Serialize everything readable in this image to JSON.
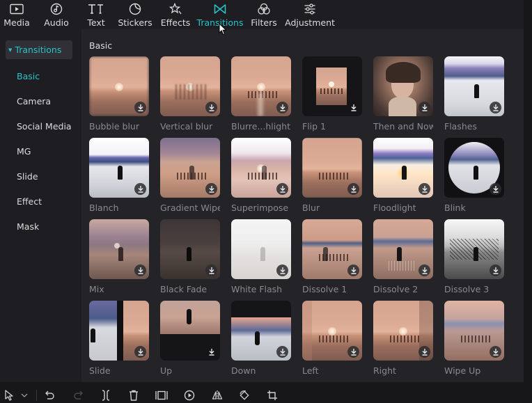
{
  "tabs": [
    {
      "label": "Media",
      "icon": "media-icon"
    },
    {
      "label": "Audio",
      "icon": "audio-icon"
    },
    {
      "label": "Text",
      "icon": "text-icon"
    },
    {
      "label": "Stickers",
      "icon": "stickers-icon"
    },
    {
      "label": "Effects",
      "icon": "effects-icon"
    },
    {
      "label": "Transitions",
      "icon": "transitions-icon",
      "active": true
    },
    {
      "label": "Filters",
      "icon": "filters-icon"
    },
    {
      "label": "Adjustment",
      "icon": "adjustment-icon"
    }
  ],
  "sidebar": {
    "header": "Transitions",
    "items": [
      {
        "label": "Basic",
        "active": true
      },
      {
        "label": "Camera"
      },
      {
        "label": "Social Media"
      },
      {
        "label": "MG"
      },
      {
        "label": "Slide"
      },
      {
        "label": "Effect"
      },
      {
        "label": "Mask"
      }
    ]
  },
  "main": {
    "section_title": "Basic",
    "items": [
      {
        "label": "Bubble blur",
        "style": "blur"
      },
      {
        "label": "Vertical blur",
        "style": "vblur"
      },
      {
        "label": "Blurre...hlight",
        "style": "sunset"
      },
      {
        "label": "Flip 1",
        "style": "flip"
      },
      {
        "label": "Then and Now",
        "style": "portrait"
      },
      {
        "label": "Flashes",
        "style": "blue"
      },
      {
        "label": "Blanch",
        "style": "blue-bright"
      },
      {
        "label": "Gradient Wipe",
        "style": "gradient"
      },
      {
        "label": "Superimpose",
        "style": "superimpose"
      },
      {
        "label": "Blur",
        "style": "sunset-blur"
      },
      {
        "label": "Floodlight",
        "style": "floodlight"
      },
      {
        "label": "Blink",
        "style": "blink"
      },
      {
        "label": "Mix",
        "style": "mix"
      },
      {
        "label": "Black Fade",
        "style": "dark"
      },
      {
        "label": "White Flash",
        "style": "white"
      },
      {
        "label": "Dissolve 1",
        "style": "dissolve"
      },
      {
        "label": "Dissolve 2",
        "style": "dissolve2"
      },
      {
        "label": "Dissolve 3",
        "style": "dissolve3"
      },
      {
        "label": "Slide",
        "style": "slide"
      },
      {
        "label": "Up",
        "style": "up"
      },
      {
        "label": "Down",
        "style": "down"
      },
      {
        "label": "Left",
        "style": "left"
      },
      {
        "label": "Right",
        "style": "right"
      },
      {
        "label": "Wipe Up",
        "style": "wipeup"
      }
    ]
  },
  "bottom_toolbar": [
    {
      "icon": "select-cursor-icon"
    },
    {
      "icon": "chevron-down-icon"
    },
    {
      "icon": "undo-icon"
    },
    {
      "icon": "redo-icon"
    },
    {
      "icon": "split-icon"
    },
    {
      "icon": "delete-icon"
    },
    {
      "icon": "trim-icon"
    },
    {
      "icon": "play-range-icon"
    },
    {
      "icon": "mirror-icon"
    },
    {
      "icon": "rotate-icon"
    },
    {
      "icon": "crop-icon"
    }
  ],
  "colors": {
    "accent": "#27c4c8",
    "panel": "#242428",
    "sidebar": "#1e1e22",
    "label_muted": "#8a8a8c"
  }
}
